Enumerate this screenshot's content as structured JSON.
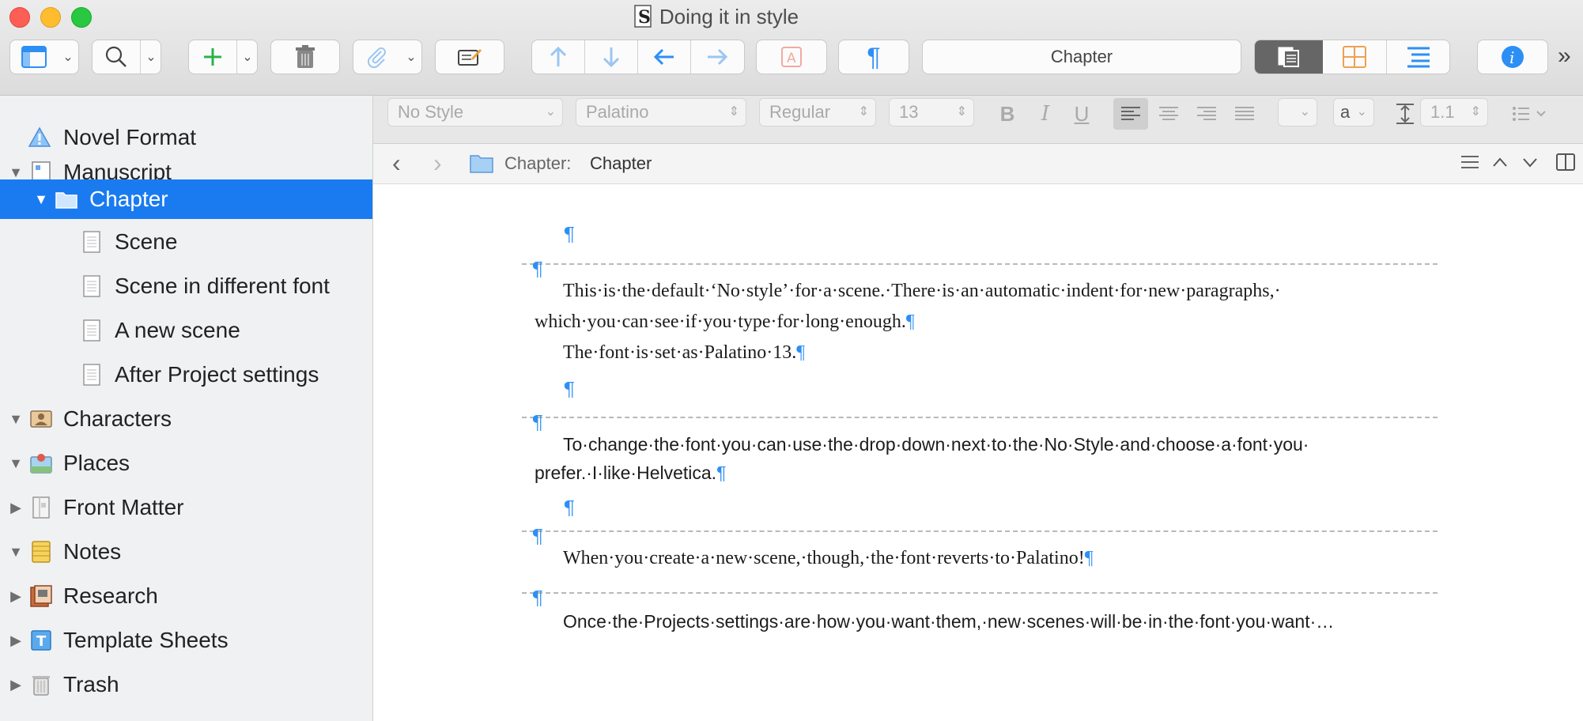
{
  "window": {
    "title": "Doing it in style"
  },
  "toolbar": {
    "chapter_label": "Chapter",
    "more": "»"
  },
  "format_bar": {
    "style": "No Style",
    "font": "Palatino",
    "weight": "Regular",
    "size": "13",
    "bold": "B",
    "italic": "I",
    "underline": "U",
    "text_color_label": "a",
    "line_spacing": "1.1"
  },
  "nav": {
    "folder_prefix": "Chapter:",
    "folder_name": "Chapter"
  },
  "binder": {
    "items": [
      {
        "label": "Novel Format"
      },
      {
        "label": "Manuscript"
      },
      {
        "label": "Chapter"
      },
      {
        "label": "Scene"
      },
      {
        "label": "Scene in different font"
      },
      {
        "label": "A new scene"
      },
      {
        "label": "After Project settings"
      },
      {
        "label": "Characters"
      },
      {
        "label": "Places"
      },
      {
        "label": "Front Matter"
      },
      {
        "label": "Notes"
      },
      {
        "label": "Research"
      },
      {
        "label": "Template Sheets"
      },
      {
        "label": "Trash"
      }
    ]
  },
  "editor": {
    "pilcrow": "¶",
    "p1_line1": "This·is·the·default·‘No·style’·for·a·scene.·There·is·an·automatic·indent·for·new·paragraphs,·",
    "p1_line2": "which·you·can·see·if·you·type·for·long·enough.",
    "p1_line3": "The·font·is·set·as·Palatino·13.",
    "p2_line1": "To·change·the·font·you·can·use·the·drop·down·next·to·the·No·Style·and·choose·a·font·you·",
    "p2_line2": "prefer.·I·like·Helvetica.",
    "p3_line1": "When·you·create·a·new·scene,·though,·the·font·reverts·to·Palatino!",
    "p4_line1": "Once·the·Projects·settings·are·how·you·want·them,·new·scenes·will·be·in·the·font·you·want·…"
  }
}
